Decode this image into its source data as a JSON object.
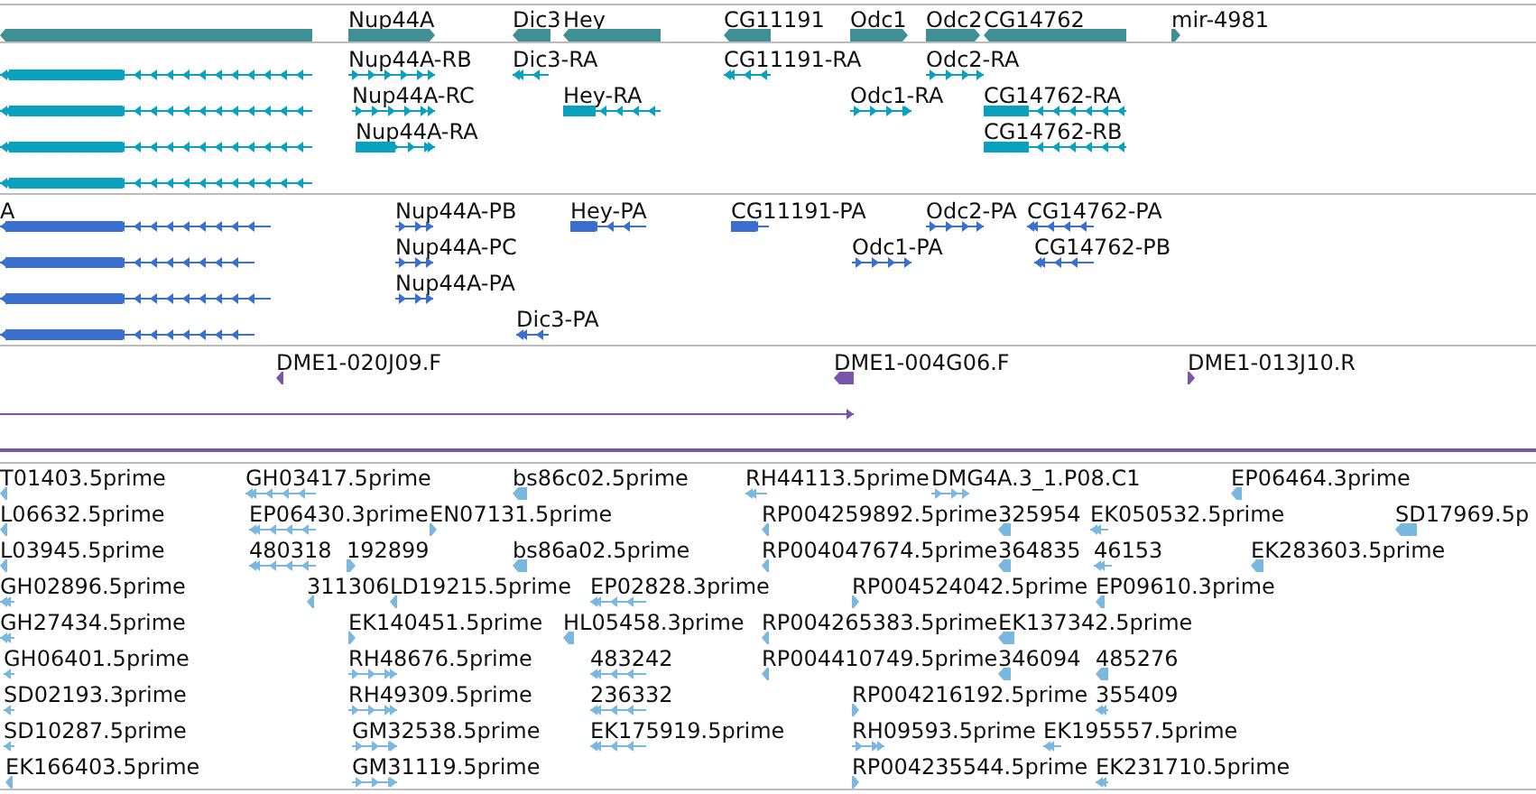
{
  "tracks": [
    {
      "kind": "gene",
      "features": [
        {
          "reverse": true
        },
        {
          "label": "Nup44A",
          "reverse": false
        },
        {
          "label": "Dic3",
          "reverse": true
        },
        {
          "label": "Hey",
          "reverse": true
        },
        {
          "label": "CG11191",
          "reverse": true
        },
        {
          "label": "Odc1",
          "reverse": false
        },
        {
          "label": "Odc2",
          "reverse": false
        },
        {
          "label": "CG14762",
          "reverse": true
        },
        {
          "label": "mir-4981",
          "reverse": false
        }
      ]
    },
    {
      "kind": "transcript",
      "features": [
        {
          "reverse": true
        },
        {
          "reverse": true
        },
        {
          "reverse": true
        },
        {
          "reverse": true
        },
        {
          "label": "Nup44A-RB",
          "reverse": false
        },
        {
          "label": "Dic3-RA",
          "reverse": true
        },
        {
          "label": "CG11191-RA",
          "reverse": true
        },
        {
          "label": "Odc2-RA",
          "reverse": false
        },
        {
          "label": "Nup44A-RC",
          "reverse": false
        },
        {
          "label": "Hey-RA",
          "reverse": true
        },
        {
          "label": "Odc1-RA",
          "reverse": false
        },
        {
          "label": "CG14762-RA",
          "reverse": true
        },
        {
          "label": "Nup44A-RA",
          "reverse": false
        },
        {
          "label": "CG14762-RB",
          "reverse": true
        }
      ]
    },
    {
      "kind": "protein",
      "features": [
        {
          "label": "A",
          "reverse": true
        },
        {
          "reverse": true
        },
        {
          "reverse": true
        },
        {
          "reverse": true
        },
        {
          "label": "Nup44A-PB",
          "reverse": false
        },
        {
          "label": "Hey-PA",
          "reverse": true
        },
        {
          "label": "CG11191-PA",
          "reverse": true
        },
        {
          "label": "Odc2-PA",
          "reverse": false
        },
        {
          "label": "CG14762-PA",
          "reverse": true
        },
        {
          "label": "Nup44A-PC",
          "reverse": false
        },
        {
          "label": "Odc1-PA",
          "reverse": false
        },
        {
          "label": "CG14762-PB",
          "reverse": true
        },
        {
          "label": "Nup44A-PA",
          "reverse": false
        },
        {
          "label": "Dic3-PA",
          "reverse": true
        }
      ]
    },
    {
      "kind": "clone",
      "features": [
        {
          "kind": "marker",
          "label": "DME1-020J09.F",
          "reverse": true
        },
        {
          "kind": "marker",
          "label": "DME1-004G06.F",
          "reverse": true
        },
        {
          "kind": "marker",
          "label": "DME1-013J10.R",
          "reverse": false
        },
        {
          "kind": "line",
          "reverse": false
        },
        {
          "kind": "span"
        }
      ]
    },
    {
      "kind": "est",
      "features": [
        {
          "label": "T01403.5prime",
          "reverse": true
        },
        {
          "label": "GH03417.5prime",
          "reverse": true
        },
        {
          "label": "bs86c02.5prime",
          "reverse": true
        },
        {
          "label": "RH44113.5prime",
          "reverse": true
        },
        {
          "label": "DMG4A.3_1.P08.C1",
          "reverse": false
        },
        {
          "label": "EP06464.3prime",
          "reverse": true
        },
        {
          "label": "L06632.5prime",
          "reverse": true
        },
        {
          "label": "EP06430.3prime",
          "reverse": true
        },
        {
          "label": "EN07131.5prime",
          "reverse": false
        },
        {
          "label": "RP004259892.5prime",
          "reverse": true
        },
        {
          "label": "325954",
          "reverse": true
        },
        {
          "label": "EK050532.5prime",
          "reverse": true
        },
        {
          "label": "SD17969.5p",
          "reverse": true
        },
        {
          "label": "L03945.5prime",
          "reverse": true
        },
        {
          "label": "480318",
          "reverse": true
        },
        {
          "label": "192899",
          "reverse": false
        },
        {
          "label": "bs86a02.5prime",
          "reverse": true
        },
        {
          "label": "RP004047674.5prime",
          "reverse": true
        },
        {
          "label": "364835",
          "reverse": true
        },
        {
          "label": "46153",
          "reverse": true
        },
        {
          "label": "EK283603.5prime",
          "reverse": true
        },
        {
          "label": "GH02896.5prime",
          "reverse": true
        },
        {
          "label": "311306",
          "reverse": true
        },
        {
          "label": "LD19215.5prime",
          "reverse": true
        },
        {
          "label": "EP02828.3prime",
          "reverse": true
        },
        {
          "label": "RP004524042.5prime",
          "reverse": false
        },
        {
          "label": "EP09610.3prime",
          "reverse": true
        },
        {
          "label": "GH27434.5prime",
          "reverse": true
        },
        {
          "label": "EK140451.5prime",
          "reverse": false
        },
        {
          "label": "HL05458.3prime",
          "reverse": true
        },
        {
          "label": "RP004265383.5prime",
          "reverse": true
        },
        {
          "label": "EK137342.5prime",
          "reverse": true
        },
        {
          "label": "GH06401.5prime",
          "reverse": true
        },
        {
          "label": "RH48676.5prime",
          "reverse": false
        },
        {
          "label": "483242",
          "reverse": true
        },
        {
          "label": "RP004410749.5prime",
          "reverse": true
        },
        {
          "label": "346094",
          "reverse": true
        },
        {
          "label": "485276",
          "reverse": true
        },
        {
          "label": "SD02193.3prime",
          "reverse": true
        },
        {
          "label": "RH49309.5prime",
          "reverse": false
        },
        {
          "label": "236332",
          "reverse": true
        },
        {
          "label": "RP004216192.5prime",
          "reverse": false
        },
        {
          "label": "355409",
          "reverse": true
        },
        {
          "label": "SD10287.5prime",
          "reverse": true
        },
        {
          "label": "GM32538.5prime",
          "reverse": false
        },
        {
          "label": "EK175919.5prime",
          "reverse": true
        },
        {
          "label": "RH09593.5prime",
          "reverse": false
        },
        {
          "label": "EK195557.5prime",
          "reverse": true
        },
        {
          "label": "EK166403.5prime",
          "reverse": true
        },
        {
          "label": "GM31119.5prime",
          "reverse": false
        },
        {
          "label": "RP004235544.5prime",
          "reverse": false
        },
        {
          "label": "EK231710.5prime",
          "reverse": true
        }
      ]
    }
  ]
}
